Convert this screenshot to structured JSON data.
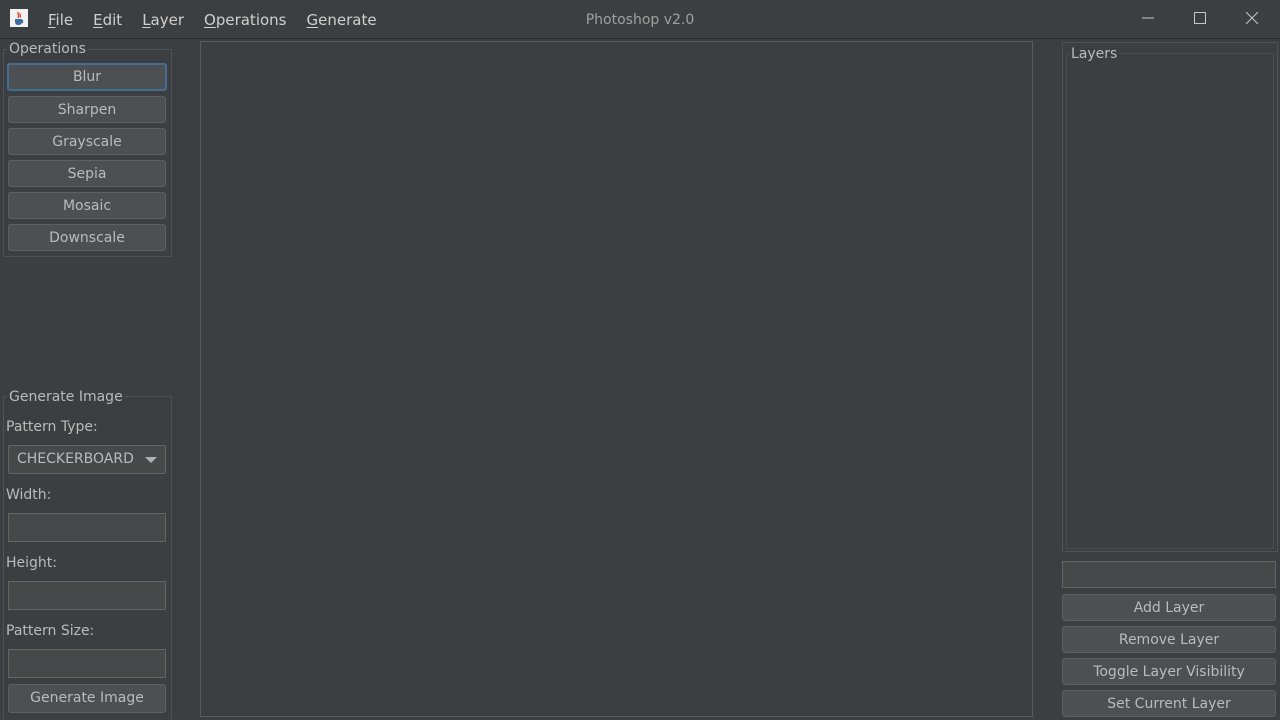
{
  "window": {
    "title": "Photoshop v2.0",
    "icon": "java-cup-icon"
  },
  "menu": {
    "items": [
      {
        "label_rest": "ile",
        "mnemonic": "F"
      },
      {
        "label_rest": "dit",
        "mnemonic": "E"
      },
      {
        "label_rest": "ayer",
        "mnemonic": "L"
      },
      {
        "label_rest": "perations",
        "mnemonic": "O"
      },
      {
        "label_rest": "enerate",
        "mnemonic": "G"
      }
    ]
  },
  "operations": {
    "legend": "Operations",
    "buttons": [
      "Blur",
      "Sharpen",
      "Grayscale",
      "Sepia",
      "Mosaic",
      "Downscale"
    ]
  },
  "generate": {
    "legend": "Generate Image",
    "pattern_type_label": "Pattern Type:",
    "pattern_type_value": "CHECKERBOARD",
    "width_label": "Width:",
    "width_value": "",
    "height_label": "Height:",
    "height_value": "",
    "pattern_size_label": "Pattern Size:",
    "pattern_size_value": "",
    "button_label": "Generate Image"
  },
  "layers": {
    "legend": "Layers",
    "name_value": "",
    "buttons": [
      "Add Layer",
      "Remove Layer",
      "Toggle Layer Visibility",
      "Set Current Layer"
    ]
  },
  "colors": {
    "background": "#3c3f41",
    "button": "#4c5052",
    "focus": "#466d94",
    "text": "#bbbbbb"
  }
}
